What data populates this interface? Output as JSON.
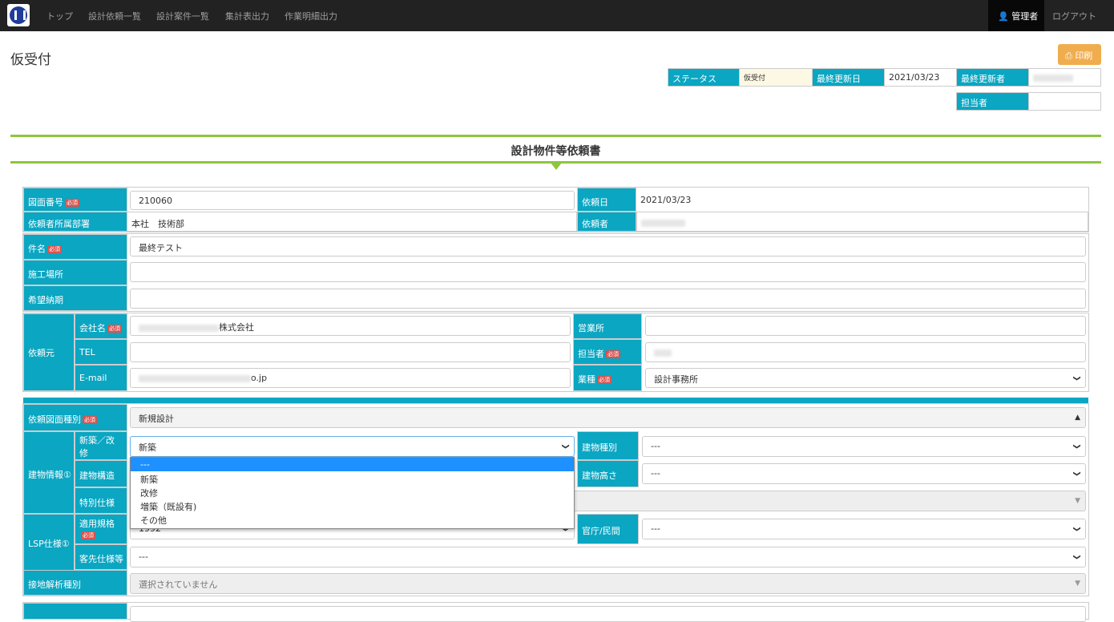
{
  "nav": {
    "items": [
      "トップ",
      "設計依頼一覧",
      "設計案件一覧",
      "集計表出力",
      "作業明細出力"
    ],
    "user": "管理者",
    "logout": "ログアウト"
  },
  "page": {
    "title": "仮受付",
    "print": "印刷"
  },
  "status": {
    "status_label": "ステータス",
    "status_value": "仮受付",
    "updated_label": "最終更新日",
    "updated_value": "2021/03/23",
    "updater_label": "最終更新者",
    "assignee_label": "担当者"
  },
  "section": {
    "title": "設計物件等依頼書"
  },
  "required": "必須",
  "form": {
    "drawing_no_label": "図面番号",
    "drawing_no": "210060",
    "request_date_label": "依頼日",
    "request_date": "2021/03/23",
    "dept_label": "依頼者所属部署",
    "dept": "本社　技術部",
    "requester_label": "依頼者",
    "subject_label": "件名",
    "subject": "最終テスト",
    "site_label": "施工場所",
    "deadline_label": "希望納期",
    "client_label": "依頼元",
    "company_label": "会社名",
    "company": "株式会社",
    "office_label": "営業所",
    "tel_label": "TEL",
    "contact_label": "担当者",
    "email_label": "E-mail",
    "email": "o.jp",
    "industry_label": "業種",
    "industry": "設計事務所",
    "drawing_type_label": "依頼図面種別",
    "drawing_type": "新規設計",
    "building_label": "建物情報①",
    "new_renov_label": "新築／改修",
    "new_renov": "新築",
    "building_type_label": "建物種別",
    "building_type": "---",
    "structure_label": "建物構造",
    "height_label": "建物高さ",
    "height": "---",
    "special_label": "特別仕様",
    "lsp_label": "LSP仕様①",
    "standard_label": "適用規格",
    "standard": "1992",
    "public_label": "官庁/民間",
    "public": "---",
    "customer_spec_label": "客先仕様等",
    "customer_spec": "---",
    "ground_label": "接地解析種別",
    "ground": "選択されていません"
  },
  "dropdown": {
    "options": [
      "---",
      "新築",
      "改修",
      "増築（既設有)",
      "その他"
    ]
  }
}
